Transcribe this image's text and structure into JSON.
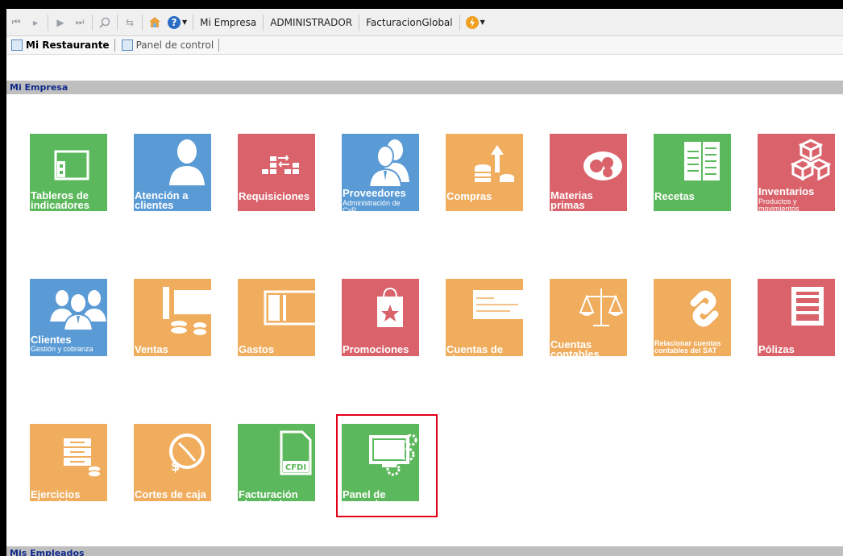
{
  "toolbar": {
    "company": "Mi Empresa",
    "user": "ADMINISTRADOR",
    "mode": "FacturacionGlobal"
  },
  "tabs": [
    {
      "label": "Mi Restaurante",
      "active": true
    },
    {
      "label": "Panel de control",
      "active": false
    }
  ],
  "sections": {
    "empresa": "Mi Empresa",
    "empleados": "Mis Empleados"
  },
  "tiles": [
    {
      "label": "Tableros de\nindicadores",
      "sub": "",
      "color": "#5cb85c",
      "icon": "dashboard-icon"
    },
    {
      "label": "Atención a\nclientes",
      "sub": "",
      "color": "#5b9bd5",
      "icon": "person-icon"
    },
    {
      "label": "Requisiciones",
      "sub": "",
      "color": "#d9626b",
      "icon": "transfer-icon"
    },
    {
      "label": "Proveedores",
      "sub": "Administración de\nCxP",
      "color": "#5b9bd5",
      "icon": "suppliers-icon"
    },
    {
      "label": "Compras",
      "sub": "",
      "color": "#f0ad5e",
      "icon": "coins-up-icon"
    },
    {
      "label": "Materias\nprimas",
      "sub": "",
      "color": "#d9626b",
      "icon": "bowl-icon"
    },
    {
      "label": "Recetas",
      "sub": "",
      "color": "#5cb85c",
      "icon": "recipe-book-icon"
    },
    {
      "label": "Inventarios",
      "sub": "Productos y\nmovimientos",
      "color": "#d9626b",
      "icon": "boxes-icon"
    },
    {
      "label": "Clientes",
      "sub": "Gestión y cobranza",
      "color": "#5b9bd5",
      "icon": "clients-group-icon"
    },
    {
      "label": "Ventas",
      "sub": "",
      "color": "#f0ad5e",
      "icon": "sales-icon"
    },
    {
      "label": "Gastos",
      "sub": "",
      "color": "#f0ad5e",
      "icon": "bills-icon"
    },
    {
      "label": "Promociones",
      "sub": "",
      "color": "#d9626b",
      "icon": "shopping-bag-icon"
    },
    {
      "label": "Cuentas de\ncheques",
      "sub": "",
      "color": "#f0ad5e",
      "icon": "cheque-icon"
    },
    {
      "label": "Cuentas\ncontables",
      "sub": "",
      "color": "#f0ad5e",
      "icon": "scales-icon"
    },
    {
      "label": "",
      "sub": "Relacionar cuentas\ncontables del SAT",
      "color": "#f0ad5e",
      "icon": "link-icon"
    },
    {
      "label": "Pólizas",
      "sub": "",
      "color": "#d9626b",
      "icon": "ledger-icon"
    },
    {
      "label": "Ejercicios\ncontables",
      "sub": "",
      "color": "#f0ad5e",
      "icon": "fiscal-years-icon"
    },
    {
      "label": "Cortes de caja",
      "sub": "",
      "color": "#f0ad5e",
      "icon": "clock-icon"
    },
    {
      "label": "Facturación\nelectrónica",
      "sub": "",
      "color": "#5cb85c",
      "icon": "cfdi-icon"
    },
    {
      "label": "Panel de\ncontrol",
      "sub": "",
      "color": "#5cb85c",
      "icon": "monitor-gears-icon"
    }
  ],
  "cfdi_text": "CFDI",
  "highlighted_tile": "Panel de\ncontrol"
}
